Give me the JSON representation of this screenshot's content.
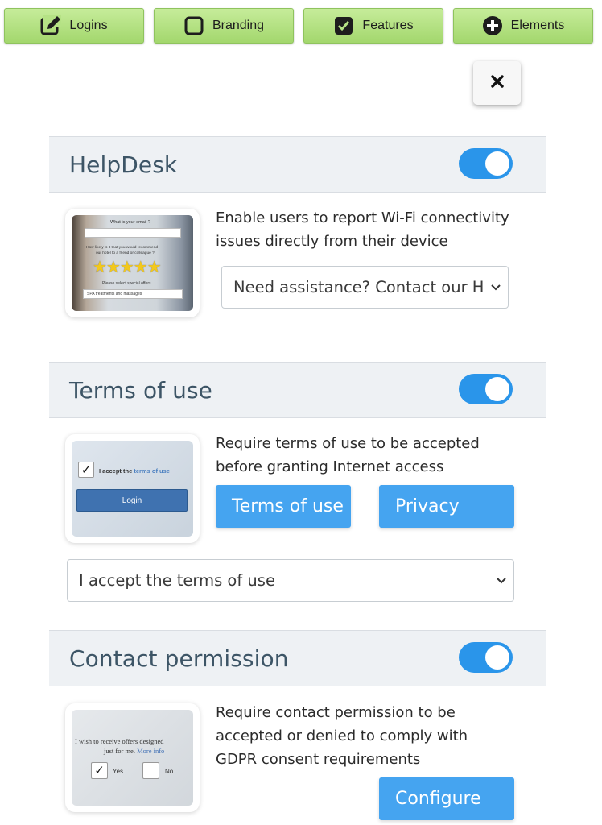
{
  "nav": {
    "logins": "Logins",
    "branding": "Branding",
    "features": "Features",
    "elements": "Elements"
  },
  "colors": {
    "nav_green": "#a3d76d",
    "toggle_blue": "#2a95ea",
    "button_blue": "#45a4f0",
    "header_bg": "#eef1f4",
    "title_color": "#3d5566"
  },
  "helpdesk": {
    "title": "HelpDesk",
    "enabled": true,
    "description_line1": "Enable users to report Wi-Fi connectivity",
    "description_line2": "issues directly from their device",
    "select_value": "Need assistance? Contact our H",
    "preview": {
      "q1": "What is your email ?",
      "q2": "How likely is it that you would recommend",
      "q3": "our hotel to a friend or colleague ?",
      "stars": "★★★★★",
      "q4": "Please select special offers",
      "option": "SPA treatments and massages"
    }
  },
  "terms": {
    "title": "Terms of use",
    "enabled": true,
    "description_line1": "Require terms of use to be accepted",
    "description_line2": "before granting Internet access",
    "terms_button": "Terms of use",
    "privacy_button": "Privacy",
    "select_value": "I accept the terms of use",
    "preview": {
      "accept_prefix": "I accept the",
      "accept_link": "terms of use",
      "login": "Login"
    }
  },
  "contact": {
    "title": "Contact permission",
    "enabled": true,
    "description_line1": "Require contact permission to be",
    "description_line2": "accepted or denied to comply with",
    "description_line3": "GDPR consent requirements",
    "configure_button": "Configure",
    "preview": {
      "line1": "I wish to receive offers designed",
      "line2_prefix": "just for me.",
      "line2_link": "More info",
      "yes": "Yes",
      "no": "No"
    }
  }
}
